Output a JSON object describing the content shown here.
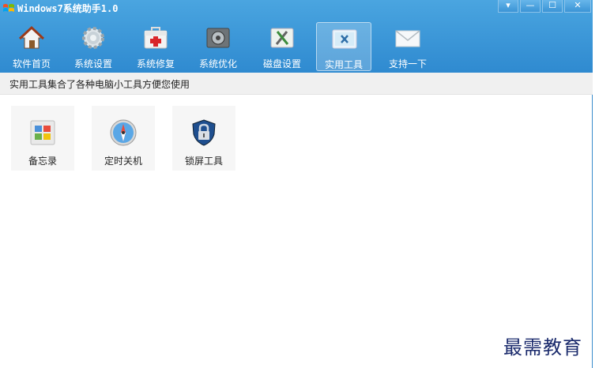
{
  "window": {
    "title": "Windows7系统助手1.0"
  },
  "controls": {
    "menu": "▾",
    "minimize": "—",
    "maximize": "☐",
    "close": "✕"
  },
  "toolbar": {
    "items": [
      {
        "label": "软件首页",
        "icon": "home-icon"
      },
      {
        "label": "系统设置",
        "icon": "gear-icon"
      },
      {
        "label": "系统修复",
        "icon": "first-aid-kit-icon"
      },
      {
        "label": "系统优化",
        "icon": "optimize-icon"
      },
      {
        "label": "磁盘设置",
        "icon": "disk-tools-icon"
      },
      {
        "label": "实用工具",
        "icon": "utility-tools-icon",
        "active": true
      },
      {
        "label": "支持一下",
        "icon": "envelope-icon"
      }
    ]
  },
  "subbar": {
    "description": "实用工具集合了各种电脑小工具方便您使用"
  },
  "tools": [
    {
      "label": "备忘录",
      "icon": "memo-icon"
    },
    {
      "label": "定时关机",
      "icon": "compass-timer-icon"
    },
    {
      "label": "锁屏工具",
      "icon": "lock-shield-icon"
    }
  ],
  "watermark": "最需教育",
  "colors": {
    "topbar": "#3b98d9",
    "accent": "#2f8ad0",
    "subbar": "#f0f0f0"
  }
}
